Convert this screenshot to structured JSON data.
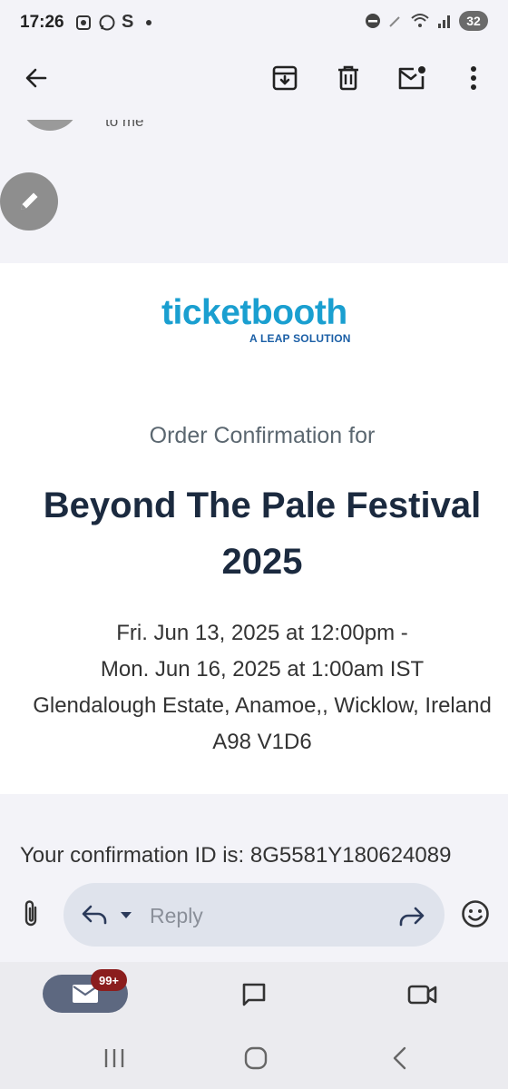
{
  "status_bar": {
    "time": "17:26",
    "battery": "32",
    "left_icons": [
      "screenshot-icon",
      "whatsapp-icon",
      "s-app-icon",
      "dot-icon"
    ],
    "right_icons": [
      "dnd-icon",
      "pen-icon",
      "wifi-icon",
      "signal-icon"
    ]
  },
  "app_bar": {
    "icons": [
      "back-arrow-icon",
      "archive-icon",
      "delete-icon",
      "mark-unread-icon",
      "more-vert-icon"
    ]
  },
  "header": {
    "recipient_fragment": "to me"
  },
  "email": {
    "logo_word": "ticketbooth",
    "logo_sub": "A LEAP SOLUTION",
    "order_heading": "Order Confirmation for",
    "event_title_line1": "Beyond The Pale Festival",
    "event_title_line2": "2025",
    "date_line1": "Fri. Jun 13, 2025 at 12:00pm -",
    "date_line2": "Mon. Jun 16, 2025 at 1:00am IST",
    "address_line1": "Glendalough Estate, Anamoe,, Wicklow, Ireland",
    "address_line2": "A98 V1D6",
    "confirmation_text": "Your confirmation ID is: 8G5581Y180624089"
  },
  "reply_bar": {
    "placeholder": "Reply"
  },
  "bottom_nav": {
    "mail_badge": "99+"
  },
  "colors": {
    "logo_blue": "#1a9fd0",
    "title_navy": "#1b2a3f",
    "badge_red": "#8b1d1d"
  }
}
